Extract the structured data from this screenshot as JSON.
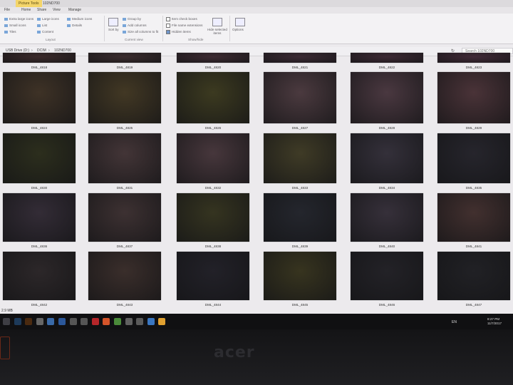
{
  "title_bar": {
    "picture_tools": "Picture Tools",
    "folder_name": "102ND700"
  },
  "ribbon": {
    "tabs": [
      "File",
      "Home",
      "Share",
      "View",
      "Manage"
    ],
    "layout_items": [
      "Extra large icons",
      "Large icons",
      "Medium icons",
      "Small icons",
      "List",
      "Details",
      "Tiles",
      "Content"
    ],
    "layout_label": "Layout",
    "sort_label": "Sort by",
    "current_view_items": [
      "Group by",
      "Add columns",
      "Size all columns to fit"
    ],
    "current_view_label": "Current view",
    "show_hide_items": [
      "Item check boxes",
      "File name extensions",
      "Hidden items"
    ],
    "show_hide_checked": [
      false,
      false,
      true
    ],
    "hide_selected": "Hide selected items",
    "show_hide_label": "Show/hide",
    "options": "Options"
  },
  "address": {
    "crumbs": [
      "USB Drive (D:)",
      "DCIM",
      "102ND700"
    ],
    "search_placeholder": "Search 102ND700"
  },
  "files": [
    {
      "name": "DML_4818",
      "color": "#3b2a2a"
    },
    {
      "name": "DML_4819",
      "color": "#3a2c2e"
    },
    {
      "name": "DML_4820",
      "color": "#3c2a31"
    },
    {
      "name": "DML_4821",
      "color": "#3b2a33"
    },
    {
      "name": "DML_4822",
      "color": "#3d2a34"
    },
    {
      "name": "DML_4823",
      "color": "#412a37"
    },
    {
      "name": "DML_4824",
      "color": "#3e3226"
    },
    {
      "name": "DML_4825",
      "color": "#423824"
    },
    {
      "name": "DML_4826",
      "color": "#3c3a20"
    },
    {
      "name": "DML_4827",
      "color": "#4b3a3f"
    },
    {
      "name": "DML_4828",
      "color": "#4a3840"
    },
    {
      "name": "DML_4829",
      "color": "#4a3338"
    },
    {
      "name": "DML_4830",
      "color": "#2c2e1d"
    },
    {
      "name": "DML_4831",
      "color": "#433537"
    },
    {
      "name": "DML_4832",
      "color": "#47373c"
    },
    {
      "name": "DML_4833",
      "color": "#3f3b26"
    },
    {
      "name": "DML_4834",
      "color": "#34303a"
    },
    {
      "name": "DML_4835",
      "color": "#26252c"
    },
    {
      "name": "DML_4836",
      "color": "#332c36"
    },
    {
      "name": "DML_4837",
      "color": "#3d3132"
    },
    {
      "name": "DML_4838",
      "color": "#353420"
    },
    {
      "name": "DML_4839",
      "color": "#24262d"
    },
    {
      "name": "DML_4840",
      "color": "#36303a"
    },
    {
      "name": "DML_4841",
      "color": "#42302f"
    },
    {
      "name": "DML_4842",
      "color": "#2c2729"
    },
    {
      "name": "DML_4843",
      "color": "#3a2e2b"
    },
    {
      "name": "DML_4844",
      "color": "#222128"
    },
    {
      "name": "DML_4845",
      "color": "#37341f"
    },
    {
      "name": "DML_4846",
      "color": "#232227"
    },
    {
      "name": "DML_4847",
      "color": "#212125"
    }
  ],
  "status": {
    "size": "2.9 MB"
  },
  "taskbar": {
    "icons": [
      {
        "name": "start",
        "color": "#3e3e44"
      },
      {
        "name": "photoshop",
        "color": "#1d3a5a"
      },
      {
        "name": "illustrator",
        "color": "#4a2a10"
      },
      {
        "name": "chrome-like",
        "color": "#666"
      },
      {
        "name": "file-explorer",
        "color": "#3a6aa8"
      },
      {
        "name": "word",
        "color": "#2b579a"
      },
      {
        "name": "app",
        "color": "#555"
      },
      {
        "name": "app2",
        "color": "#555"
      },
      {
        "name": "red-app",
        "color": "#b5262a"
      },
      {
        "name": "firefox",
        "color": "#d4542a"
      },
      {
        "name": "chrome",
        "color": "#4a8a3a"
      },
      {
        "name": "app3",
        "color": "#606060"
      },
      {
        "name": "app4",
        "color": "#5a5a5a"
      },
      {
        "name": "photos",
        "color": "#3a76c0"
      },
      {
        "name": "paint",
        "color": "#e0a030"
      }
    ],
    "lang": "EN",
    "time": "8:27 PM",
    "date": "11/7/2017"
  },
  "bezel": {
    "brand": "acer"
  }
}
